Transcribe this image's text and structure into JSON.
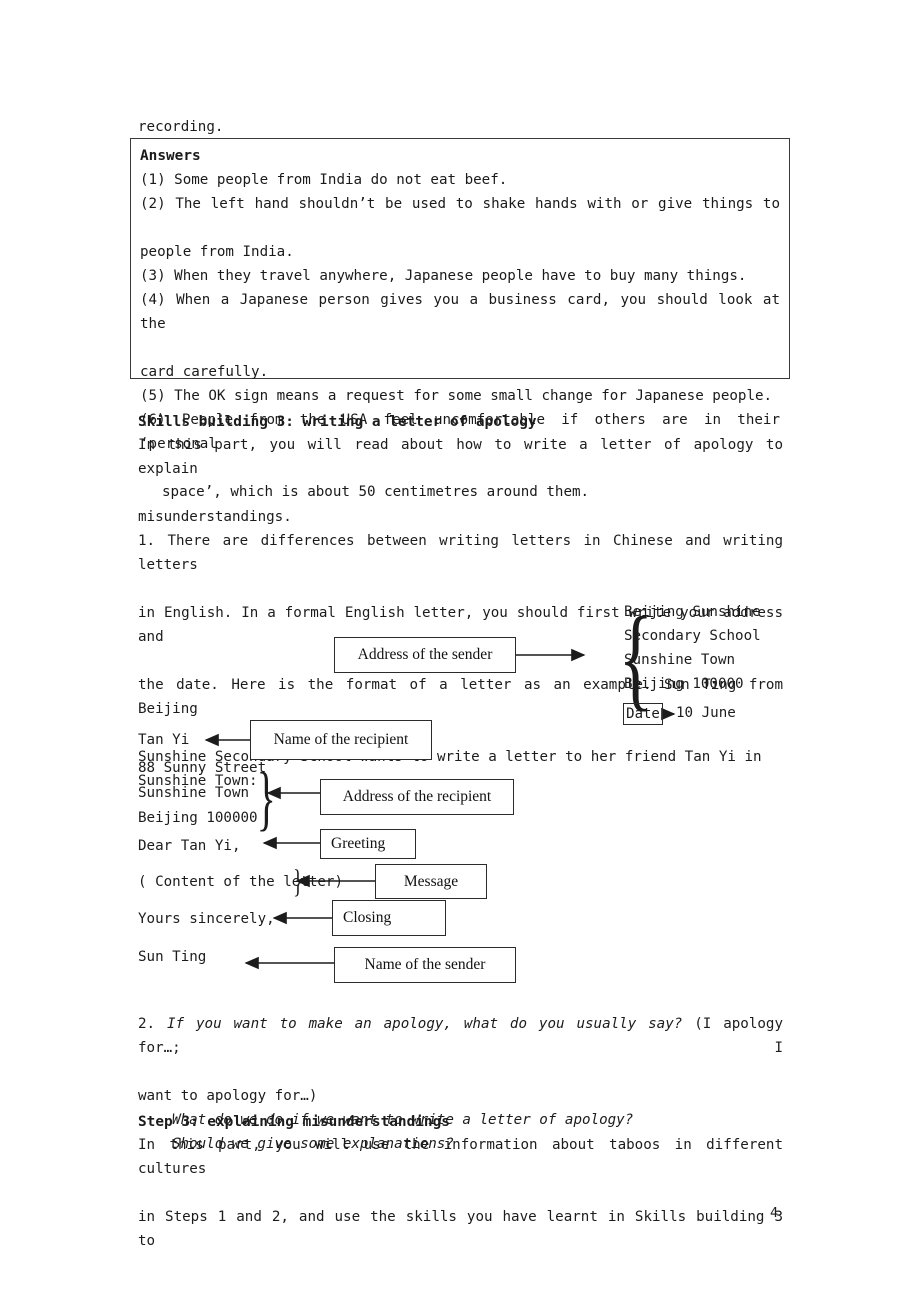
{
  "page": {
    "number": "4",
    "intro_line": "recording."
  },
  "answers": {
    "title": "Answers",
    "items": [
      "(1) Some people from India do not eat beef.",
      "(2) The left hand shouldn’t be used to shake hands with or give things to people from India.",
      "(3) When they travel anywhere, Japanese people have to buy many things.",
      "(4) When a Japanese person gives you a business card, you should look at the card carefully.",
      "(5) The OK sign means a request for some small change for Japanese people.",
      "(6) People from the USA feel uncomfortable if others are in their ‘personal space’, which is about 50 centimetres around them."
    ],
    "lines": [
      {
        "text": "(1) Some people from India do not eat beef.",
        "justify": false,
        "indent": false
      },
      {
        "text": "(2) The left hand shouldn’t be used to shake hands with or give things to",
        "justify": true,
        "indent": false
      },
      {
        "text": "people from India.",
        "justify": false,
        "indent": false
      },
      {
        "text": "(3) When they travel anywhere, Japanese people have to buy many things.",
        "justify": false,
        "indent": false
      },
      {
        "text": "(4) When a Japanese person gives you a business card, you should look at the",
        "justify": true,
        "indent": false
      },
      {
        "text": "card carefully.",
        "justify": false,
        "indent": false
      },
      {
        "text": "(5) The OK sign means a request for some small change for Japanese people.",
        "justify": false,
        "indent": false
      },
      {
        "text": "(6) People from the USA feel uncomfortable if others are in their ‘personal",
        "justify": true,
        "indent": false
      },
      {
        "text": "space’, which is about 50 centimetres around them.",
        "justify": false,
        "indent": true
      }
    ]
  },
  "skills_building": {
    "heading": "Skills building 3: writing a letter of apology",
    "lines": [
      {
        "text": "In this part, you will read about how to write a letter of apology to explain",
        "justify": true
      },
      {
        "text": "misunderstandings.",
        "justify": false
      },
      {
        "text": "1. There are differences between writing letters in Chinese and writing letters",
        "justify": true
      },
      {
        "text": "in English. In a formal English letter, you should first write your address and",
        "justify": true
      },
      {
        "text": "the date. Here is the format of a letter as an example. Sun Ting from Beijing",
        "justify": true
      },
      {
        "text": "Sunshine Secondary School wants to write a letter to her friend Tan Yi in",
        "justify": false
      },
      {
        "text": "Sunshine Town:",
        "justify": false
      }
    ]
  },
  "diagram": {
    "labels": {
      "address_of_sender": "Address of the sender",
      "name_of_recipient": "Name of the recipient",
      "address_of_recipient": "Address of the recipient",
      "greeting": "Greeting",
      "message": "Message",
      "closing": "Closing",
      "name_of_sender": "Name of the sender",
      "date": "Date"
    },
    "sender_address": [
      "Beijing Sunshine",
      "Secondary School",
      "Sunshine Town",
      "Beijing 100000"
    ],
    "date_value": "10 June",
    "recipient_block": [
      "Tan Yi",
      "88 Sunny Street",
      "Sunshine Town",
      "Beijing 100000"
    ],
    "greeting_text": "Dear Tan Yi,",
    "body_text": "( Content of the letter)",
    "closing_text": "Yours sincerely,",
    "sender_name": "Sun Ting",
    "brace_left": "{",
    "brace_right": "}"
  },
  "tail": {
    "lines": [
      {
        "text": "2. If you want to make an apology, what do you usually say? (I apology for…; I",
        "justify": true,
        "indent": false,
        "italic_prefix": true
      },
      {
        "text": "want to apology for…)",
        "justify": false,
        "indent": false,
        "italic_prefix": false
      },
      {
        "text": "What do we do if we want to write a letter of apology?",
        "justify": false,
        "indent": true,
        "italic_prefix": false
      },
      {
        "text": "Should we give some explanations?",
        "justify": false,
        "indent": true,
        "italic_prefix": false
      }
    ],
    "q2_italic": "If you want to make an apology, what do you usually say?",
    "q2_number": "2. ",
    "q2_rest": " (I apology for…; I",
    "q2_cont": "want to apology for…)",
    "q3_italic": "What do we do if we want to write a letter of apology?",
    "q4_italic": "Should we give some explanations?"
  },
  "step3": {
    "heading": "Step 3: explaining misunderstandings",
    "lines": [
      {
        "text": "In this part, you will use the information about taboos in different cultures",
        "justify": true
      },
      {
        "text": "in Steps 1 and 2, and use the skills you have learnt in Skills building 3 to",
        "justify": true
      }
    ]
  }
}
